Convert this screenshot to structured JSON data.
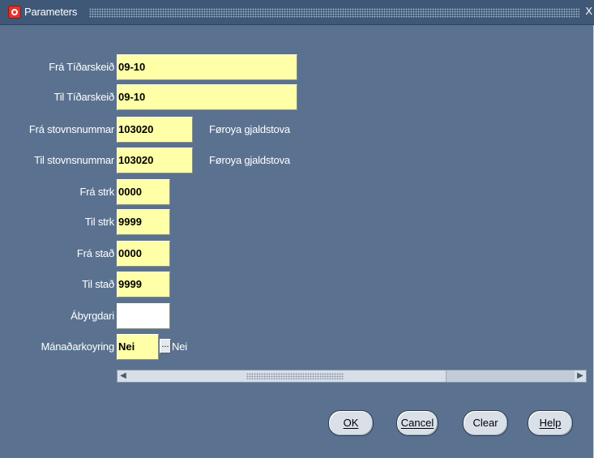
{
  "window": {
    "title": "Parameters",
    "close_glyph": "X",
    "colors": {
      "background": "#5a7290",
      "field": "#ffffa8",
      "titlebar": "#3f5877"
    }
  },
  "form": {
    "rows": [
      {
        "label": "Frá Tíðarskeið",
        "value": "09-10"
      },
      {
        "label": "Til Tíðarskeið",
        "value": "09-10"
      },
      {
        "label": "Frá stovnsnummar",
        "value": "103020",
        "description": "Føroya gjaldstova"
      },
      {
        "label": "Til stovnsnummar",
        "value": "103020",
        "description": "Føroya gjaldstova"
      },
      {
        "label": "Frá strk",
        "value": "0000"
      },
      {
        "label": "Til strk",
        "value": "9999"
      },
      {
        "label": "Frá stað",
        "value": "0000"
      },
      {
        "label": "Til stað",
        "value": "9999"
      },
      {
        "label": "Ábyrgdari",
        "value": ""
      },
      {
        "label": "Mánaðarkoyring",
        "value": "Nei",
        "lov_glyph": "...",
        "description": "Nei"
      }
    ]
  },
  "scrollbar": {
    "left_glyph": "◀",
    "right_glyph": "▶"
  },
  "buttons": {
    "ok": "OK",
    "cancel": "Cancel",
    "clear": "Clear",
    "help": "Help"
  }
}
